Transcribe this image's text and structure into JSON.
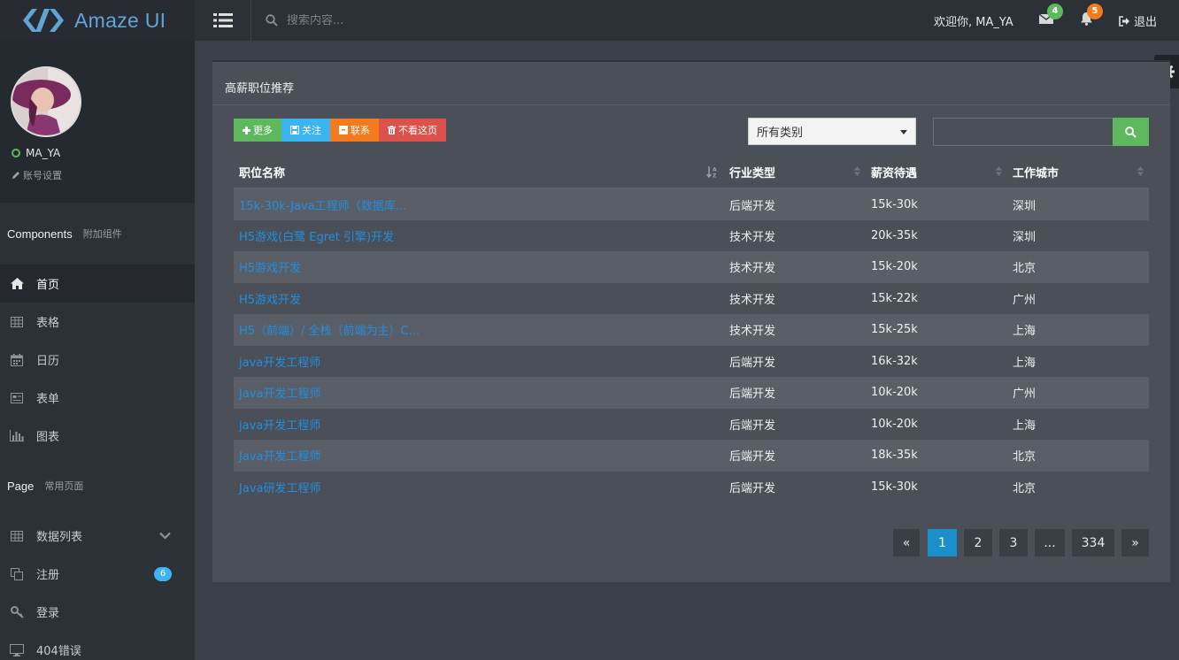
{
  "header": {
    "logo_text": "Amaze UI",
    "search_placeholder": "搜索内容...",
    "welcome": "欢迎你, MA_YA",
    "mail_count": "4",
    "notify_count": "5",
    "logout": "退出",
    "colors": {
      "mail_badge": "#5eb95e",
      "notify_badge": "#f37b1d"
    }
  },
  "sidebar": {
    "username": "MA_YA",
    "account_settings": "账号设置",
    "components_title": "Components",
    "components_sub": "附加组件",
    "components_items": [
      {
        "label": "首页",
        "icon": "home-icon"
      },
      {
        "label": "表格",
        "icon": "table-icon"
      },
      {
        "label": "日历",
        "icon": "calendar-icon"
      },
      {
        "label": "表单",
        "icon": "form-icon"
      },
      {
        "label": "图表",
        "icon": "bar-chart-icon"
      }
    ],
    "page_title": "Page",
    "page_sub": "常用页面",
    "page_items": [
      {
        "label": "数据列表",
        "icon": "table-icon"
      },
      {
        "label": "注册",
        "icon": "clone-icon",
        "badge": "6"
      },
      {
        "label": "登录",
        "icon": "key-icon"
      },
      {
        "label": "404错误",
        "icon": "monitor-icon"
      }
    ]
  },
  "panel": {
    "title": "高薪职位推荐",
    "buttons": [
      {
        "label": "更多",
        "icon": "plus-icon",
        "color": "#5eb95e"
      },
      {
        "label": "关注",
        "icon": "save-icon",
        "color": "#3bb4f2"
      },
      {
        "label": "联系",
        "icon": "archive-icon",
        "color": "#f37b1d"
      },
      {
        "label": "不看这页",
        "icon": "trash-icon",
        "color": "#dd514c"
      }
    ],
    "category_select": "所有类别",
    "table": {
      "headers": [
        "职位名称",
        "行业类型",
        "薪资待遇",
        "工作城市"
      ],
      "rows": [
        [
          "15k-30k-Java工程师（数据库...",
          "后端开发",
          "15k-30k",
          "深圳"
        ],
        [
          "H5游戏(白鹭 Egret 引擎)开发",
          "技术开发",
          "20k-35k",
          "深圳"
        ],
        [
          "H5游戏开发",
          "技术开发",
          "15k-20k",
          "北京"
        ],
        [
          "H5游戏开发",
          "技术开发",
          "15k-22k",
          "广州"
        ],
        [
          "H5（前端）/ 全栈（前端为主）C...",
          "技术开发",
          "15k-25k",
          "上海"
        ],
        [
          "java开发工程师",
          "后端开发",
          "16k-32k",
          "上海"
        ],
        [
          "Java开发工程师",
          "后端开发",
          "10k-20k",
          "广州"
        ],
        [
          "java开发工程师",
          "后端开发",
          "10k-20k",
          "上海"
        ],
        [
          "Java开发工程师",
          "后端开发",
          "18k-35k",
          "北京"
        ],
        [
          "Java研发工程师",
          "后端开发",
          "15k-30k",
          "北京"
        ]
      ]
    },
    "pagination": {
      "prev": "«",
      "pages": [
        "1",
        "2",
        "3",
        "...",
        "334"
      ],
      "next": "»",
      "current": "1"
    }
  }
}
